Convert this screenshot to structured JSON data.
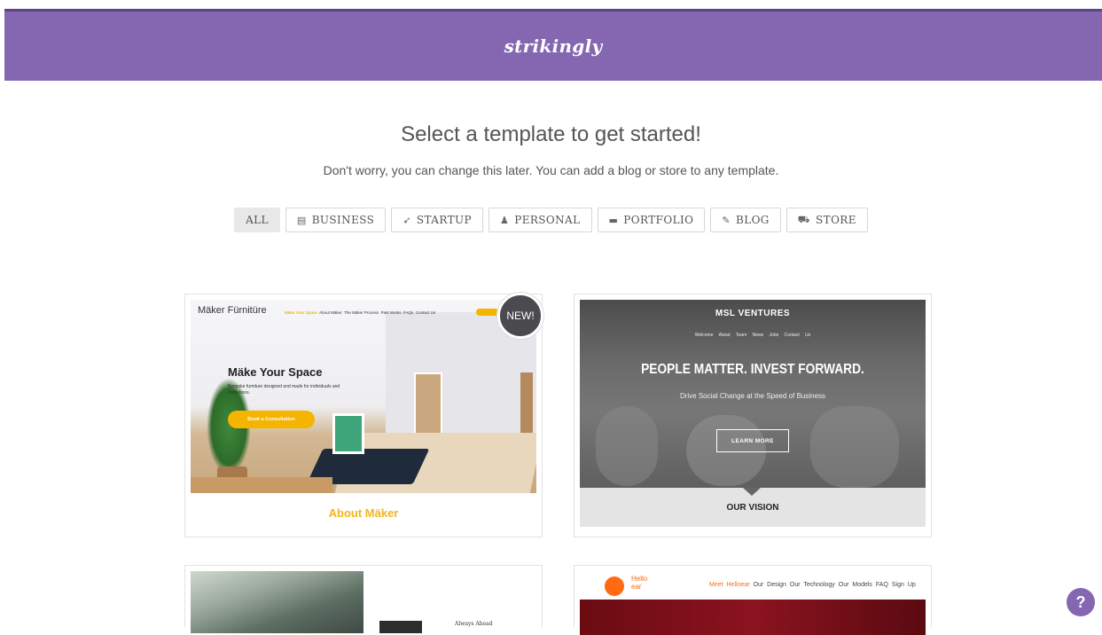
{
  "header": {
    "logo": "strikingly",
    "brand_color": "#8466b1"
  },
  "intro": {
    "title": "Select a template to get started!",
    "subtitle": "Don't worry, you can change this later. You can add a blog or store to any template."
  },
  "filters": [
    {
      "label": "ALL",
      "icon": "none",
      "active": true
    },
    {
      "label": "BUSINESS",
      "icon": "copy-icon"
    },
    {
      "label": "STARTUP",
      "icon": "rocket-icon"
    },
    {
      "label": "PERSONAL",
      "icon": "user-icon"
    },
    {
      "label": "PORTFOLIO",
      "icon": "briefcase-icon"
    },
    {
      "label": "BLOG",
      "icon": "pen-icon"
    },
    {
      "label": "STORE",
      "icon": "cart-icon"
    }
  ],
  "templates": {
    "maker": {
      "badge": "NEW!",
      "logo": "Mäker Fürnitüre",
      "nav": [
        "Mäke Your Space",
        "About Mäker",
        "The Mäker Process",
        "Past Works",
        "FAQs",
        "Contact Us"
      ],
      "hero_title": "Mäke Your Space",
      "hero_desc": "Bespoke furniture designed and made for individuals and institutions.",
      "cta": "Book a Consultation",
      "caption": "About Mäker",
      "accent": "#f5b400"
    },
    "msl": {
      "brand": "MSL VENTURES",
      "nav": [
        "Welcome",
        "About",
        "Team",
        "News",
        "Jobs",
        "Contact Us"
      ],
      "hero": "PEOPLE MATTER. INVEST FORWARD.",
      "sub": "Drive Social Change at the Speed of Business",
      "button": "LEARN MORE",
      "caption": "OUR VISION"
    },
    "third": {
      "text": "Always Ahead"
    },
    "hello": {
      "logo_line1": "Hello",
      "logo_line2": "ear",
      "nav_active": "Meet Helloear",
      "nav": [
        "Our Design",
        "Our Technology",
        "Our Models",
        "FAQ",
        "Sign Up"
      ],
      "accent": "#ff6a13"
    }
  },
  "help": {
    "label": "?"
  }
}
